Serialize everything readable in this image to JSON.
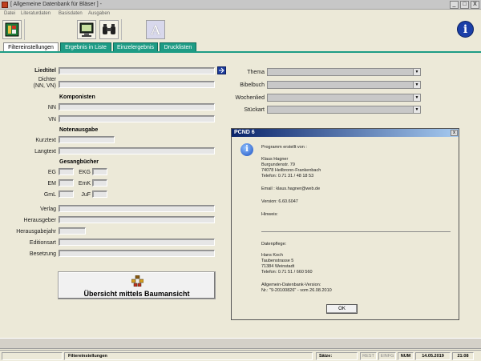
{
  "window": {
    "title": "[ Allgemeine Datenbank für Bläser ] -",
    "min": "_",
    "max": "□",
    "close": "X"
  },
  "menu": [
    "Datei",
    "Literaturdaten",
    "Basisdaten",
    "Ausgaben"
  ],
  "toolbar": {
    "text_tool_glyph": "A",
    "info_glyph": "i"
  },
  "tabs": [
    "Filtereinstellungen",
    "Ergebnis in Liste",
    "Einzelergebnis",
    "Drucklisten"
  ],
  "form": {
    "liedtitel": "Liedtitel",
    "dichter": "Dichter",
    "dichter_sub": "(NN, VN)",
    "komponisten": "Komponisten",
    "nn": "NN",
    "vn": "VN",
    "notenausgabe": "Notenausgabe",
    "kurztext": "Kurztext",
    "langtext": "Langtext",
    "gesangbuecher": "Gesangbücher",
    "eg": "EG",
    "ekg": "EKG",
    "em": "EM",
    "emk": "EmK",
    "gml": "GmL",
    "juf": "JuF",
    "verlag": "Verlag",
    "herausgeber": "Herausgeber",
    "herausgabejahr": "Herausgabejahr",
    "editionsart": "Editionsart",
    "besetzung": "Besetzung",
    "thema": "Thema",
    "bibelbuch": "Bibelbuch",
    "wochenlied": "Wochenlied",
    "stueckart": "Stückart",
    "tree_button": "Übersicht mittels Baumansicht"
  },
  "dialog": {
    "title": "PCND 6",
    "close": "x",
    "info_glyph": "i",
    "lines": [
      "Programm erstellt von :",
      "Klaus Hagner",
      "Burgundenstr. 79",
      "74078 Heilbronn-Frankenbach",
      "Telefon: 0.71 31 / 48 18 53",
      "Email  : klaus.hagner@web.de",
      "Version:  6.60.6047",
      "Hinweis:",
      "Datenpflege:",
      "Hans Koch",
      "Taubenstrasse 5",
      "71384 Weinstadt",
      "Telefon: 0.71 51 / 660 560",
      "Allgemein-Datenbank-Version:",
      "Nr.: \"9-20100826\"  - vom 26.08.2010"
    ],
    "ok": "OK"
  },
  "status": {
    "mode": "Filtereinstellungen",
    "saetze": "Sätze:",
    "rest": "REST",
    "einfg": "EINFG",
    "num": "NUM",
    "date": "14.05.2019",
    "time": "21:08"
  }
}
